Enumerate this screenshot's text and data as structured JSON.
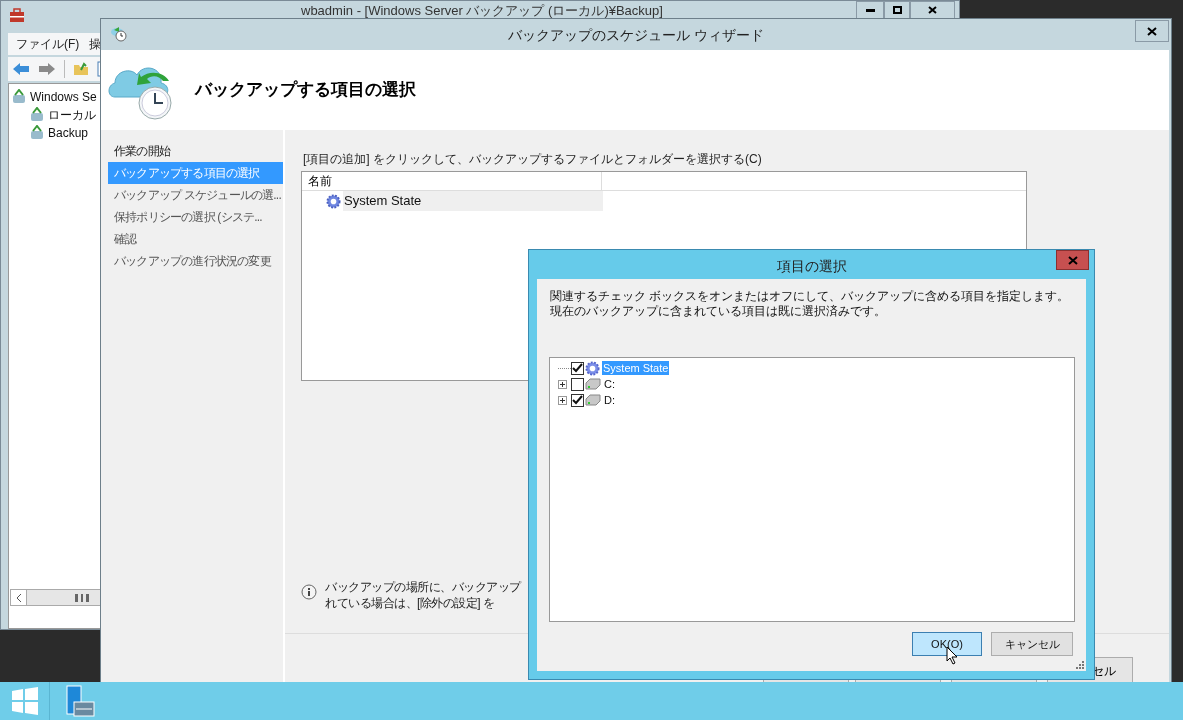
{
  "background_window": {
    "title": "wbadmin - [Windows Server バックアップ (ローカル)¥Backup]",
    "menu": [
      "ファイル(F)",
      "操"
    ],
    "tree": [
      {
        "label": "Windows Se",
        "children": [
          {
            "label": "ローカル"
          },
          {
            "label": "Backup"
          }
        ]
      }
    ]
  },
  "wizard": {
    "title": "バックアップのスケジュール ウィザード",
    "heading": "バックアップする項目の選択",
    "steps": [
      {
        "label": "作業の開始",
        "selected": false
      },
      {
        "label": "バックアップする項目の選択",
        "selected": true
      },
      {
        "label": "バックアップ スケジュールの選...",
        "selected": false
      },
      {
        "label": "保持ポリシーの選択 (システ...",
        "selected": false
      },
      {
        "label": "確認",
        "selected": false
      },
      {
        "label": "バックアップの進行状況の変更",
        "selected": false
      }
    ],
    "instruction": "[項目の追加] をクリックして、バックアップするファイルとフォルダーを選択する(C)",
    "list": {
      "columns": [
        "名前"
      ],
      "rows": [
        "System State"
      ]
    },
    "info": [
      "バックアップの場所に、バックアップ",
      "れている場合は、[除外の設定] を"
    ],
    "cancel_button": "セル"
  },
  "dialog": {
    "title": "項目の選択",
    "description": "関連するチェック ボックスをオンまたはオフにして、バックアップに含める項目を指定します。現在のバックアップに含まれている項目は既に選択済みです。",
    "tree": [
      {
        "label": "System State",
        "kind": "system",
        "checked": true,
        "selected": true
      },
      {
        "label": "C:",
        "kind": "drive",
        "checked": false,
        "selected": false
      },
      {
        "label": "D:",
        "kind": "drive",
        "checked": true,
        "selected": false
      }
    ],
    "buttons": [
      {
        "label": "OK(O)",
        "selected": true
      },
      {
        "label": "キャンセル",
        "selected": false
      }
    ]
  }
}
